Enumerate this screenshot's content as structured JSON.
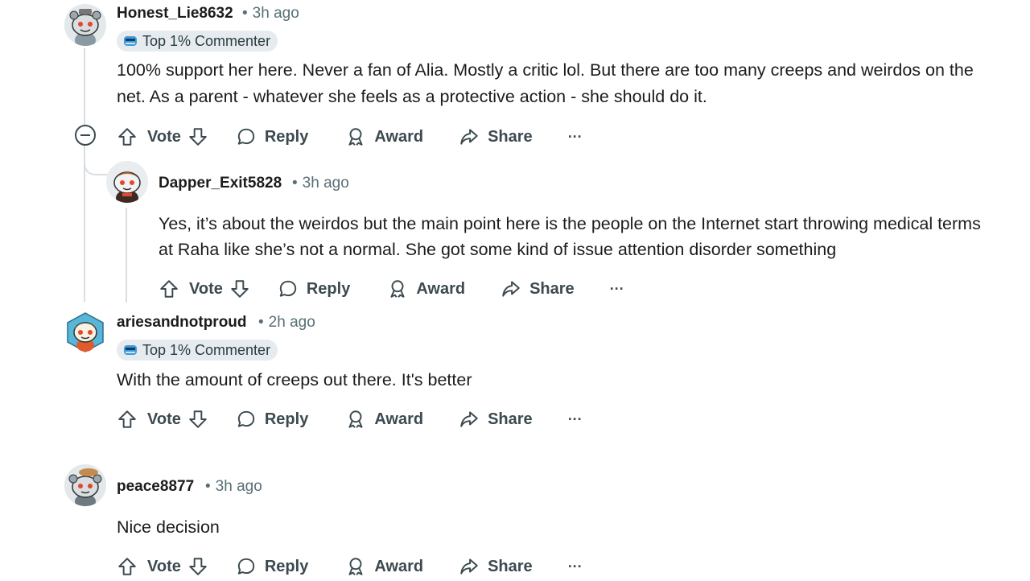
{
  "colors": {
    "text": "#1c1c1c",
    "meta": "#576f76",
    "badge_bg": "#e5ebee",
    "thread_line": "#d7dde0"
  },
  "actions": {
    "vote": "Vote",
    "reply": "Reply",
    "award": "Award",
    "share": "Share",
    "more": "···"
  },
  "comments": [
    {
      "username": "Honest_Lie8632",
      "time": "3h ago",
      "badge": "Top 1% Commenter",
      "avatar": "snoo-avatar-grey-icon",
      "text": "100% support her here. Never a fan of Alia. Mostly a critic lol. But there are too many creeps and weirdos on the net. As a parent - whatever she feels as a protective action - she should do it."
    },
    {
      "username": "Dapper_Exit5828",
      "time": "3h ago",
      "avatar": "snoo-avatar-brown-icon",
      "text": "Yes, it’s about the weirdos but the main point here is the people on the Internet start throwing medical terms at Raha like she’s not a normal. She got some kind of issue attention disorder something"
    },
    {
      "username": "ariesandnotproud",
      "time": "2h ago",
      "badge": "Top 1% Commenter",
      "avatar": "snoo-avatar-yellow-icon",
      "text": "With the amount of creeps out there. It's better"
    },
    {
      "username": "peace8877",
      "time": "3h ago",
      "avatar": "snoo-avatar-grey-hat-icon",
      "text": "Nice decision"
    }
  ]
}
